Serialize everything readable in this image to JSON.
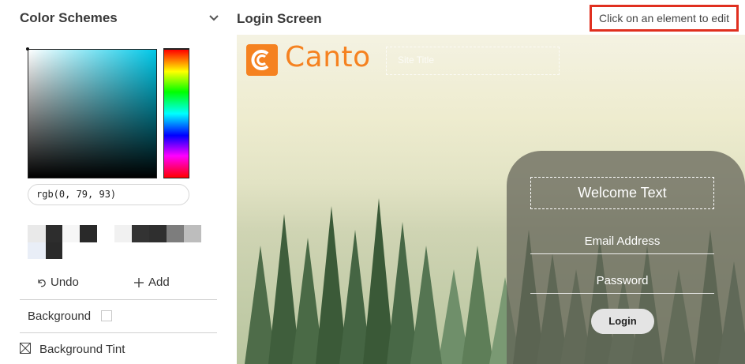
{
  "sidebar": {
    "title": "Color Schemes",
    "color_value": "rgb(0, 79, 93)",
    "swatches": [
      {
        "color": "#e9e9e9"
      },
      {
        "color": "#2d2d2d"
      },
      {
        "color": "#f6f6f6"
      },
      {
        "color": "#292929"
      },
      {
        "color": "#ffffff"
      },
      {
        "color": "#f1f1f1"
      },
      {
        "color": "#333333"
      },
      {
        "color": "#2f2f2f"
      },
      {
        "color": "#7d7d7d"
      },
      {
        "color": "#bdbdbd"
      },
      {
        "color": "#e9eef7"
      },
      {
        "color": "#2a2a2a"
      }
    ],
    "undo_label": "Undo",
    "add_label": "Add",
    "background_label": "Background",
    "background_tint_label": "Background Tint"
  },
  "main": {
    "title": "Login Screen",
    "hint": "Click on an element to edit"
  },
  "preview": {
    "logo_text": "Canto",
    "site_title": "Site Title",
    "welcome": "Welcome Text",
    "email_label": "Email Address",
    "password_label": "Password",
    "login_label": "Login"
  },
  "colors": {
    "accent": "#f58220",
    "hint_border": "#e02f1f"
  }
}
